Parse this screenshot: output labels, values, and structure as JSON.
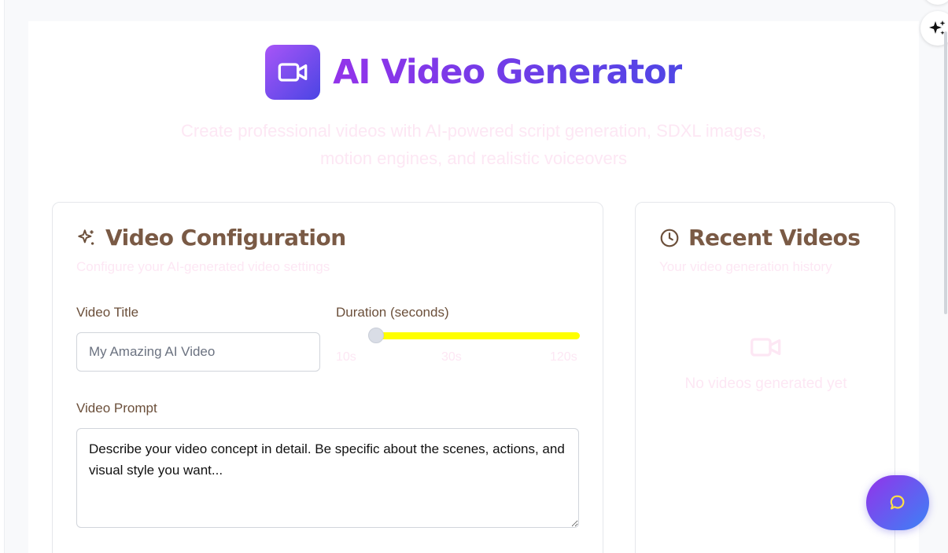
{
  "header": {
    "title": "AI Video Generator",
    "subtitle_line1": "Create professional videos with AI-powered script generation, SDXL images,",
    "subtitle_line2": "motion engines, and realistic voiceovers"
  },
  "config": {
    "title": "Video Configuration",
    "description": "Configure your AI-generated video settings",
    "video_title_label": "Video Title",
    "video_title_placeholder": "My Amazing AI Video",
    "duration_label": "Duration (seconds)",
    "duration_min_label": "10s",
    "duration_mid_label": "30s",
    "duration_max_label": "120s",
    "duration_value_fraction": 0.14,
    "prompt_label": "Video Prompt",
    "prompt_placeholder": "Describe your video concept in detail. Be specific about the scenes, actions, and visual style you want..."
  },
  "recent": {
    "title": "Recent Videos",
    "description": "Your video generation history",
    "empty_text": "No videos generated yet"
  },
  "colors": {
    "accent_start": "#9333ea",
    "accent_end": "#4f46e5",
    "slider_fill": "#ffff00",
    "heading": "#7a5a45"
  },
  "icons": {
    "logo": "video-camera-icon",
    "config": "sparkles-icon",
    "recent": "clock-icon",
    "empty": "video-camera-icon",
    "chat": "chat-bubble-icon",
    "top_right": "sparkles-icon"
  }
}
